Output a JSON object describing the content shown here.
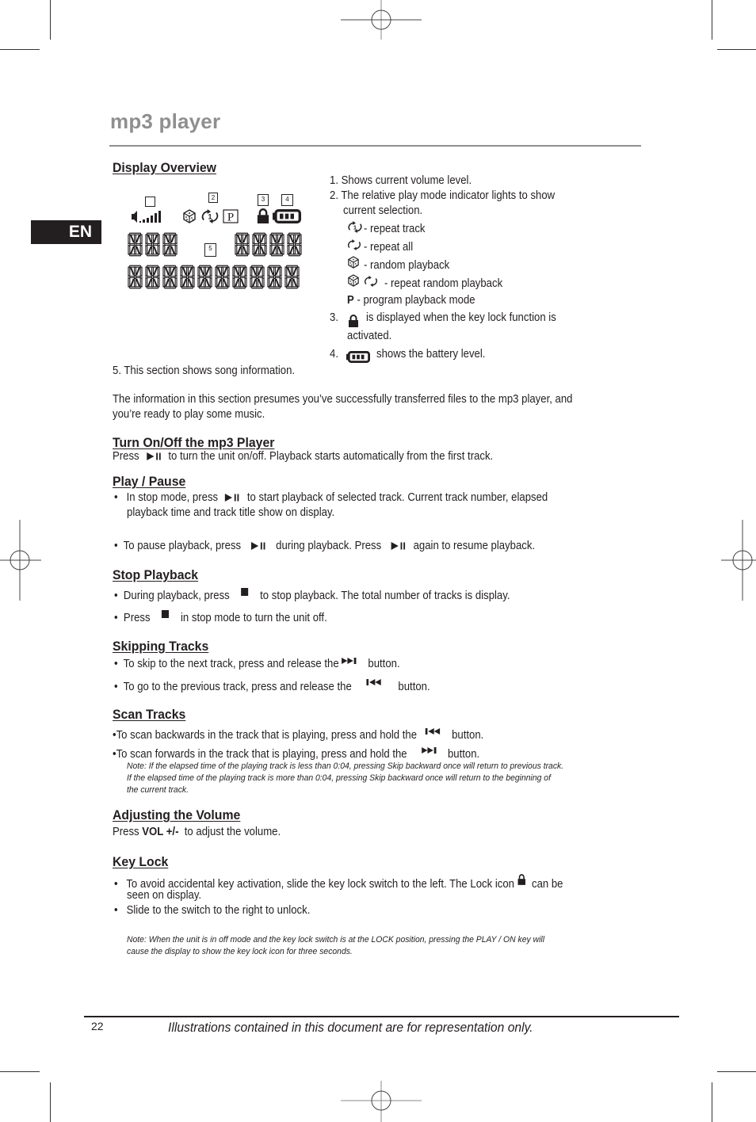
{
  "page": {
    "title": "mp3 player",
    "language_badge": "EN",
    "page_number": "22",
    "footer_note": "Illustrations contained in this document are for representation only."
  },
  "display_overview": {
    "heading": "Display Overview",
    "callouts": [
      "2",
      "3",
      "4",
      "5"
    ],
    "items": {
      "item1": "1.  Shows current volume level.",
      "item2_line1": "2. The relative play mode indicator lights to show",
      "item2_line2": "current selection.",
      "mode_repeat_track": "- repeat track",
      "mode_repeat_all": "- repeat all",
      "mode_random": "- random playback",
      "mode_repeat_random": "- repeat random playback",
      "mode_program_key": "P",
      "mode_program": "- program playback mode",
      "item3_num": "3.",
      "item3_line1": "is displayed when the key lock function is",
      "item3_line2": "activated.",
      "item4_num": "4.",
      "item4": "shows the battery level.",
      "item5": "5. This section shows song information."
    },
    "intro_line1": "The information in this section presumes you’ve successfully transferred files to the mp3 player, and",
    "intro_line2": "you’re ready to play some music."
  },
  "turn_on_off": {
    "heading": "Turn On/Off the mp3 Player",
    "pre": "Press",
    "post": "to turn the unit on/off. Playback starts automatically from the first track."
  },
  "play_pause": {
    "heading": "Play / Pause",
    "b1_pre": "In stop mode, press",
    "b1_post": "to start playback of selected track. Current track number, elapsed",
    "b1_line2": "playback time and track title show on display.",
    "b2_pre": "To pause playback, press",
    "b2_mid": "during playback. Press",
    "b2_post": "again to resume playback."
  },
  "stop_playback": {
    "heading": "Stop Playback",
    "b1_pre": "During playback, press",
    "b1_post": "to stop playback. The total number of tracks is display.",
    "b2_pre": "Press",
    "b2_post": "in stop mode to turn the unit off."
  },
  "skipping_tracks": {
    "heading": "Skipping Tracks",
    "b1_pre": "To skip to the next track, press and release the",
    "b1_post": "button.",
    "b2_pre": "To go to the previous track, press and release the",
    "b2_post": "button."
  },
  "scan_tracks": {
    "heading": "Scan Tracks",
    "b1_pre": "•To scan backwards in the track that is playing, press and hold the",
    "b1_post": "button.",
    "b2_pre": "•To scan forwards in the track that is playing, press and hold the",
    "b2_post": "button.",
    "note_line1": "Note: If the elapsed time of the playing track is less than 0:04, pressing Skip backward once will return to previous track.",
    "note_line2": "If the elapsed time of the playing track is more than 0:04, pressing Skip backward once will return to the beginning of",
    "note_line3": "the current track."
  },
  "volume": {
    "heading": "Adjusting the Volume",
    "pre": "Press",
    "key": "VOL +/-",
    "post": "to adjust the volume."
  },
  "key_lock": {
    "heading": "Key Lock",
    "b1_pre": "To avoid accidental key activation, slide the key lock switch to the left. The Lock icon",
    "b1_post": "can be",
    "b1_line2": "seen on display.",
    "b2": "Slide to the switch to the right to unlock.",
    "note_line1": "Note: When the unit is in off mode and the  key lock switch is at the LOCK position, pressing the PLAY / ON key will",
    "note_line2": "cause the display to show the key lock icon for three seconds."
  },
  "bullet": "•",
  "icons": {
    "play_pause": "play-pause-icon",
    "stop": "stop-icon",
    "next": "skip-next-icon",
    "prev": "skip-previous-icon",
    "lock": "lock-icon",
    "battery": "battery-icon",
    "volume": "volume-icon",
    "repeat_one": "repeat-track-icon",
    "repeat_all": "repeat-all-icon",
    "random": "random-dice-icon",
    "program": "program-icon"
  }
}
